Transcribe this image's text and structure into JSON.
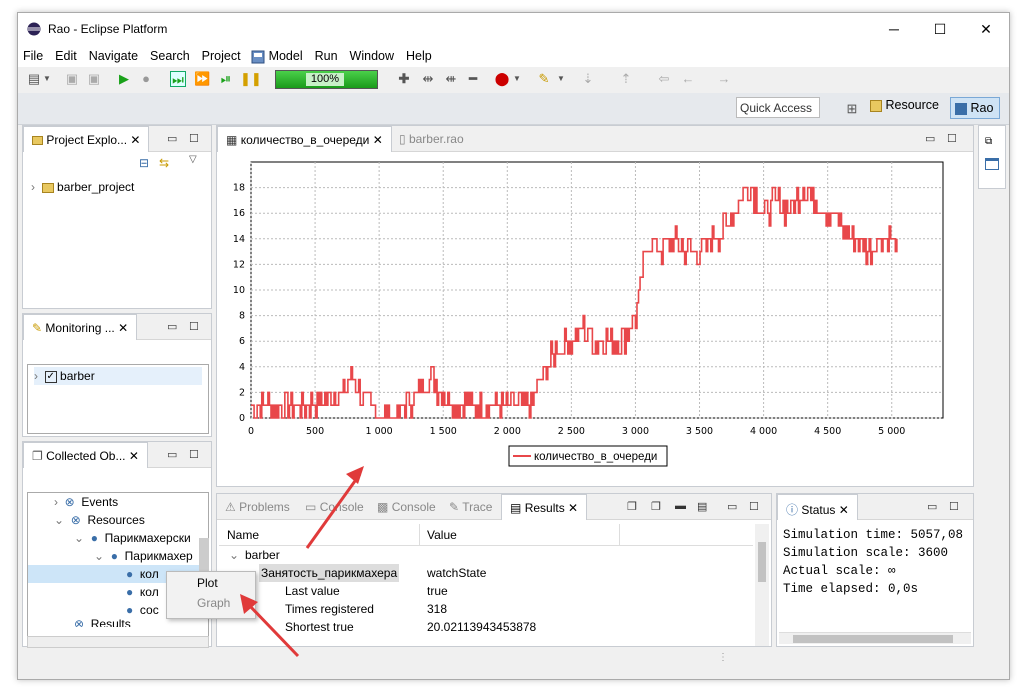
{
  "window": {
    "title": "Rao - Eclipse Platform",
    "min": "─",
    "max": "☐",
    "close": "✕"
  },
  "menu": [
    "File",
    "Edit",
    "Navigate",
    "Search",
    "Project",
    "Model",
    "Run",
    "Window",
    "Help"
  ],
  "toolbar": {
    "progress_label": "100%",
    "progress_value": 1.0
  },
  "perspectives": {
    "quick_access": "Quick Access",
    "resource": "Resource",
    "rao": "Rao"
  },
  "project_explorer": {
    "tab": "Project Explo...",
    "items": [
      "barber_project"
    ]
  },
  "monitoring": {
    "tab": "Monitoring ...",
    "items": [
      "barber"
    ]
  },
  "collected": {
    "tab": "Collected Ob...",
    "items": [
      "Events",
      "Resources",
      "Парикмахерски",
      "Парикмахер",
      "кол",
      "кол",
      "сос",
      "Results"
    ]
  },
  "context_menu": {
    "plot": "Plot",
    "graph": "Graph"
  },
  "editor": {
    "tab_active": "количество_в_очереди",
    "tab_other": "barber.rao"
  },
  "chart_data": {
    "type": "line",
    "series": [
      {
        "name": "количество_в_очереди",
        "color": "#e8474a"
      }
    ],
    "xlim": [
      0,
      5400
    ],
    "ylim": [
      0,
      20
    ],
    "x_ticks": [
      "0",
      "500",
      "1 000",
      "1 500",
      "2 000",
      "2 500",
      "3 000",
      "3 500",
      "4 000",
      "4 500",
      "5 000"
    ],
    "y_ticks": [
      "0",
      "2",
      "4",
      "6",
      "8",
      "10",
      "12",
      "14",
      "16",
      "18"
    ],
    "grid": true,
    "legend": "bottom",
    "trend": [
      [
        0,
        1
      ],
      [
        100,
        1
      ],
      [
        300,
        1
      ],
      [
        500,
        1
      ],
      [
        700,
        2
      ],
      [
        800,
        3
      ],
      [
        900,
        1
      ],
      [
        1000,
        0
      ],
      [
        1100,
        0
      ],
      [
        1200,
        1
      ],
      [
        1300,
        2
      ],
      [
        1400,
        3
      ],
      [
        1500,
        2
      ],
      [
        1600,
        1
      ],
      [
        1700,
        1
      ],
      [
        1800,
        1
      ],
      [
        1900,
        1
      ],
      [
        2000,
        1
      ],
      [
        2100,
        1
      ],
      [
        2200,
        1
      ],
      [
        2250,
        3
      ],
      [
        2350,
        5
      ],
      [
        2500,
        6
      ],
      [
        2600,
        7
      ],
      [
        2700,
        6
      ],
      [
        2800,
        6
      ],
      [
        2900,
        6
      ],
      [
        3000,
        8
      ],
      [
        3050,
        11
      ],
      [
        3100,
        14
      ],
      [
        3200,
        13
      ],
      [
        3300,
        14
      ],
      [
        3400,
        13
      ],
      [
        3500,
        13
      ],
      [
        3600,
        14
      ],
      [
        3700,
        15
      ],
      [
        3800,
        17
      ],
      [
        3900,
        18
      ],
      [
        4000,
        16
      ],
      [
        4100,
        17
      ],
      [
        4200,
        16
      ],
      [
        4300,
        18
      ],
      [
        4400,
        17
      ],
      [
        4500,
        16
      ],
      [
        4600,
        15
      ],
      [
        4700,
        14
      ],
      [
        4800,
        13
      ],
      [
        4900,
        14
      ],
      [
        5000,
        14
      ],
      [
        5050,
        13
      ]
    ]
  },
  "bottom_tabs": [
    "Problems",
    "Console",
    "Console",
    "Trace",
    "Results"
  ],
  "results": {
    "columns": [
      "Name",
      "Value"
    ],
    "rows": [
      {
        "name": "barber",
        "value": ""
      },
      {
        "name": "Занятость_парикмахера",
        "value": "watchState"
      },
      {
        "name": "Last value",
        "value": "true"
      },
      {
        "name": "Times registered",
        "value": "318"
      },
      {
        "name": "Shortest true",
        "value": "20.02113943453878"
      }
    ]
  },
  "status": {
    "tab": "Status",
    "lines": [
      "Simulation time: 5057,08",
      "Simulation scale: 3600",
      "Actual scale: ∞",
      "Time elapsed: 0,0s"
    ]
  }
}
